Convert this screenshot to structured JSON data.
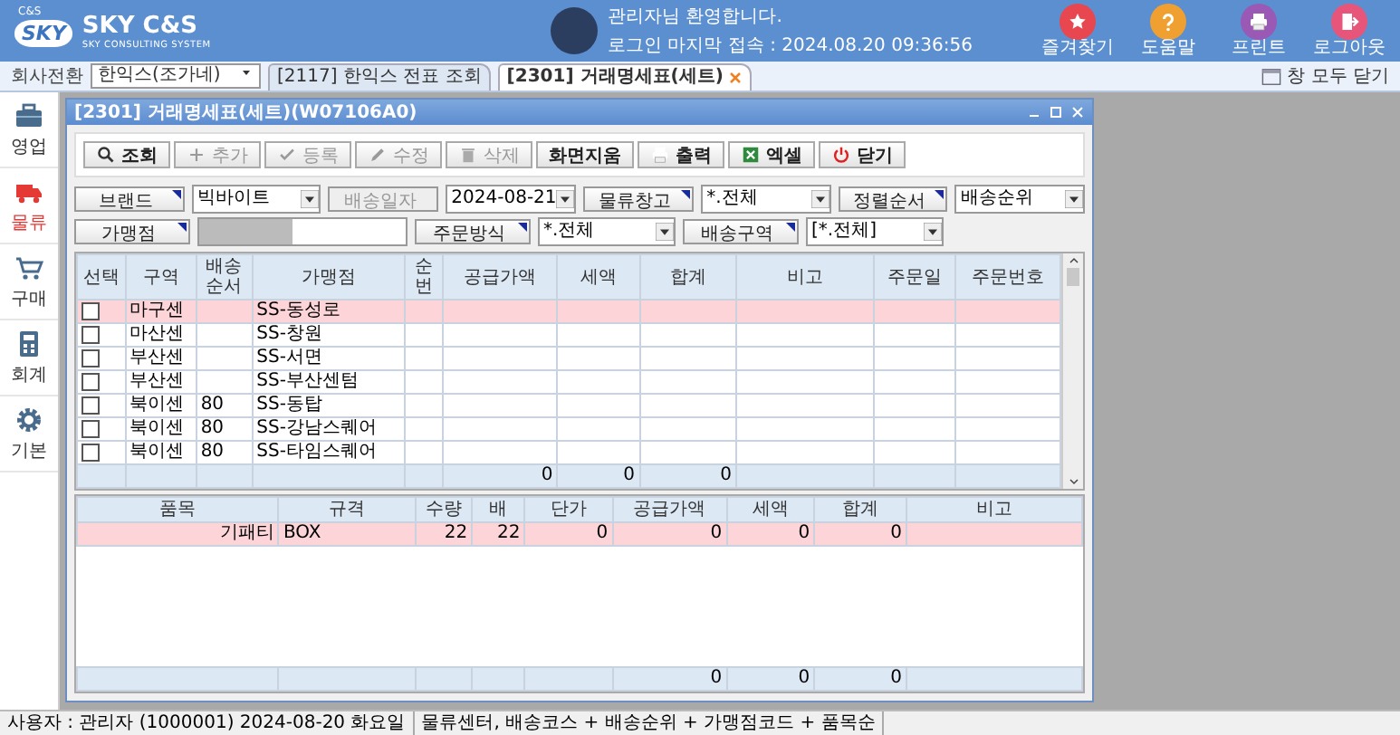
{
  "header": {
    "logo_mark": "SKY",
    "logo_small": "C&S",
    "logo": "SKY C&S",
    "tagline": "SKY CONSULTING SYSTEM",
    "welcome": "관리자님 환영합니다.",
    "last_login": "로그인 마지막 접속 : 2024.08.20 09:36:56",
    "actions": [
      {
        "label": "즐겨찾기",
        "kind": "star",
        "color": "#e8474f"
      },
      {
        "label": "도움말",
        "kind": "help",
        "color": "#f0a030"
      },
      {
        "label": "프린트",
        "kind": "printer",
        "color": "#9b59b6"
      },
      {
        "label": "로그아웃",
        "kind": "logout",
        "color": "#e8557a"
      }
    ]
  },
  "company": {
    "label": "회사전환",
    "value": "한익스(조가네)"
  },
  "tabs": [
    {
      "label": "[2117] 한익스 전표 조회",
      "selected": false
    },
    {
      "label": "[2301] 거래명세표(세트)",
      "selected": true
    }
  ],
  "close_all": "창 모두 닫기",
  "sidebar": {
    "items": [
      {
        "label": "영업",
        "kind": "briefcase",
        "selected": false
      },
      {
        "label": "물류",
        "kind": "truck",
        "selected": true
      },
      {
        "label": "구매",
        "kind": "cart",
        "selected": false
      },
      {
        "label": "회계",
        "kind": "calculator",
        "selected": false
      },
      {
        "label": "기본",
        "kind": "gear",
        "selected": false
      }
    ]
  },
  "window": {
    "title": "[2301] 거래명세표(세트)(W07106A0)",
    "toolbar": [
      {
        "label": "조회",
        "kind": "search",
        "disabled": false
      },
      {
        "label": "추가",
        "kind": "plus",
        "disabled": true
      },
      {
        "label": "등록",
        "kind": "check",
        "disabled": true
      },
      {
        "label": "수정",
        "kind": "pencil",
        "disabled": true
      },
      {
        "label": "삭제",
        "kind": "trash",
        "disabled": true
      },
      {
        "label": "화면지움",
        "kind": "text",
        "disabled": false
      },
      {
        "label": "출력",
        "kind": "printer",
        "disabled": false
      },
      {
        "label": "엑셀",
        "kind": "excel",
        "disabled": false
      },
      {
        "label": "닫기",
        "kind": "power",
        "disabled": false
      }
    ],
    "filters": [
      [
        {
          "label": "브랜드",
          "label_disabled": false,
          "kind": "select",
          "value": "빅바이트"
        },
        {
          "label": "배송일자",
          "label_disabled": true,
          "kind": "select",
          "value": "2024-08-21"
        },
        {
          "label": "물류창고",
          "label_disabled": false,
          "kind": "select",
          "value": "*.전체"
        },
        {
          "label": "정렬순서",
          "label_disabled": false,
          "kind": "select",
          "value": "배송순위"
        }
      ],
      [
        {
          "label": "가맹점",
          "label_disabled": false,
          "kind": "text"
        },
        {
          "label": "주문방식",
          "label_disabled": false,
          "kind": "select",
          "value": "*.전체"
        },
        {
          "label": "배송구역",
          "label_disabled": false,
          "kind": "select",
          "value": "[*.전체]"
        }
      ]
    ],
    "grid": {
      "columns": [
        {
          "label": "선택"
        },
        {
          "label": "구역"
        },
        {
          "label": "배송순서"
        },
        {
          "label": "가맹점"
        },
        {
          "label": "순번"
        },
        {
          "label": "공급가액",
          "total": "0"
        },
        {
          "label": "세액",
          "total": "0"
        },
        {
          "label": "합계",
          "total": "0"
        },
        {
          "label": "비고"
        },
        {
          "label": "주문일"
        },
        {
          "label": "주문번호"
        }
      ],
      "rows": [
        {
          "checked": false,
          "selected": true,
          "zone": "마구센",
          "store": "SS-동성로"
        },
        {
          "checked": false,
          "selected": false,
          "zone": "마산센",
          "store": "SS-창원"
        },
        {
          "checked": false,
          "selected": false,
          "zone": "부산센",
          "store": "SS-서면"
        },
        {
          "checked": false,
          "selected": false,
          "zone": "부산센",
          "store": "SS-부산센텀"
        },
        {
          "checked": false,
          "selected": false,
          "zone": "북이센",
          "order": "80",
          "store": "SS-동탑"
        },
        {
          "checked": false,
          "selected": false,
          "zone": "북이센",
          "order": "80",
          "store": "SS-강남스퀘어"
        },
        {
          "checked": false,
          "selected": false,
          "zone": "북이센",
          "order": "80",
          "store": "SS-타임스퀘어"
        }
      ]
    },
    "detail": {
      "columns": [
        {
          "label": "품목"
        },
        {
          "label": "규격"
        },
        {
          "label": "수량"
        },
        {
          "label": "배"
        },
        {
          "label": "단가"
        },
        {
          "label": "공급가액",
          "total": "0"
        },
        {
          "label": "세액",
          "total": "0"
        },
        {
          "label": "합계",
          "total": "0"
        },
        {
          "label": "비고"
        }
      ],
      "rows": [
        {
          "selected": true,
          "cells": [
            "기패티",
            "BOX",
            "22",
            "22",
            "0",
            "0",
            "0",
            "0"
          ]
        }
      ]
    }
  },
  "status_bar": {
    "user": "사용자 : 관리자 (1000001) 2024-08-20 화요일",
    "sort": "물류센터, 배송코스 + 배송순위 + 가맹점코드 + 품목순"
  }
}
